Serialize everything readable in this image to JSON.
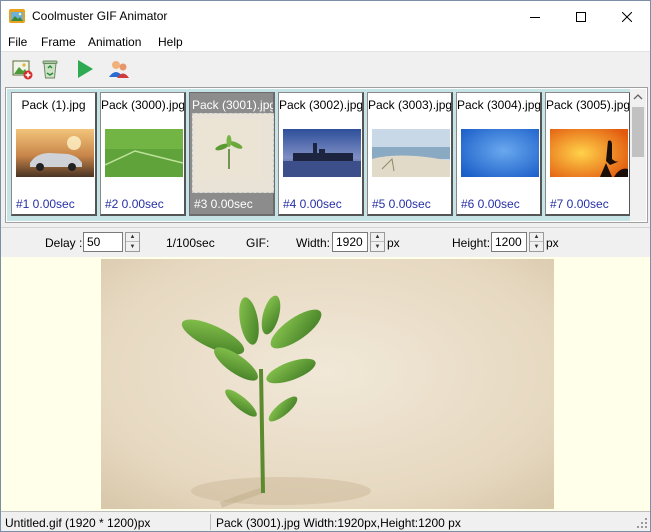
{
  "window": {
    "title": "Coolmuster GIF Animator",
    "icons": {
      "app": "gif-animator-app-icon",
      "minimize": "minimize-icon",
      "maximize": "maximize-icon",
      "close": "close-icon"
    }
  },
  "menu": {
    "items": [
      {
        "label": "File"
      },
      {
        "label": "Frame"
      },
      {
        "label": "Animation"
      },
      {
        "label": "Help"
      }
    ]
  },
  "toolbar": {
    "buttons": [
      {
        "icon": "add-image-icon"
      },
      {
        "icon": "recycle-bin-icon"
      },
      {
        "icon": "play-icon"
      },
      {
        "icon": "users-icon"
      }
    ]
  },
  "frames": [
    {
      "name": "Pack  (1).jpg",
      "info": "#1  0.00sec",
      "thumb": "car-thumbnail"
    },
    {
      "name": "Pack  (3000).jpg",
      "info": "#2  0.00sec",
      "thumb": "green-field-thumbnail"
    },
    {
      "name": "Pack  (3001).jpg",
      "info": "#3  0.00sec",
      "thumb": "sprout-thumbnail",
      "selected": true
    },
    {
      "name": "Pack  (3002).jpg",
      "info": "#4  0.00sec",
      "thumb": "city-skyline-thumbnail"
    },
    {
      "name": "Pack  (3003).jpg",
      "info": "#5  0.00sec",
      "thumb": "beach-thumbnail"
    },
    {
      "name": "Pack  (3004).jpg",
      "info": "#6  0.00sec",
      "thumb": "blue-abstract-thumbnail"
    },
    {
      "name": "Pack  (3005).jpg",
      "info": "#7  0.00sec",
      "thumb": "heron-sunset-thumbnail"
    }
  ],
  "props": {
    "delay_label": "Delay :",
    "delay_value": "50",
    "delay_unit": "1/100sec",
    "gif_label": "GIF:",
    "width_label": "Width:",
    "width_value": "1920",
    "width_unit": "px",
    "height_label": "Height:",
    "height_value": "1200",
    "height_unit": "px"
  },
  "preview": {
    "image": "sprout-in-sand-image"
  },
  "status": {
    "left": "Untitled.gif (1920 * 1200)px",
    "right": "Pack  (3001).jpg Width:1920px,Height:1200 px"
  },
  "colors": {
    "strip_bg": "#c6e4e6",
    "frame_info_text": "#2630a6",
    "selected_frame": "#8c8c8c",
    "preview_bg": "#ffffea"
  }
}
